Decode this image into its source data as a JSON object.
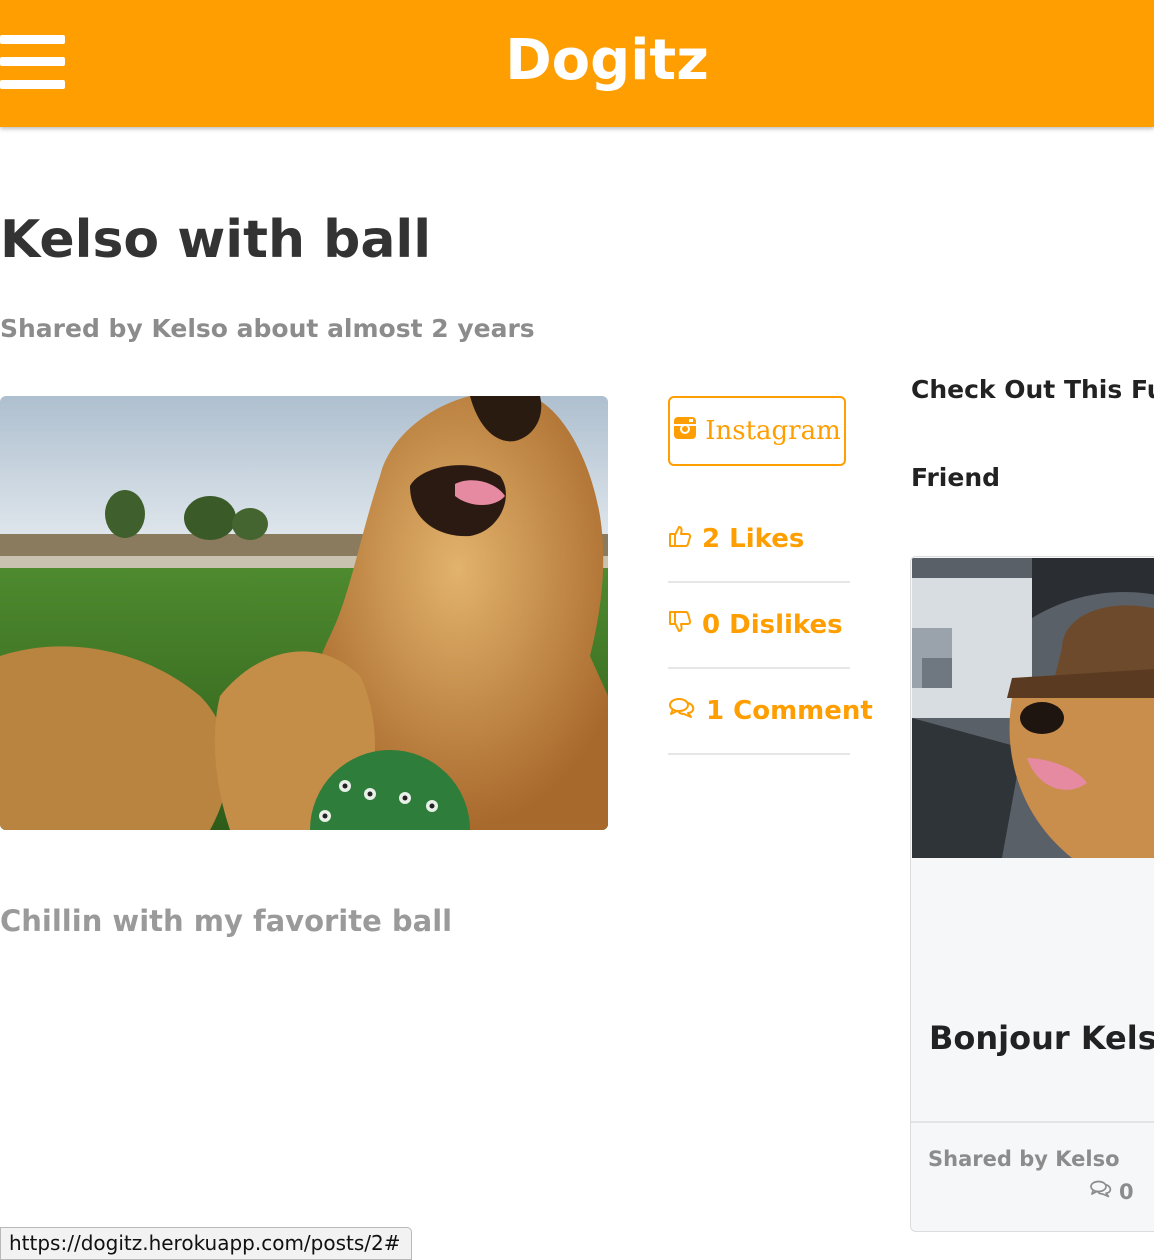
{
  "navbar": {
    "brand": "Dogitz",
    "menu_icon": "hamburger-menu-icon",
    "background_color": "#ff9e00"
  },
  "post": {
    "title": "Kelso with ball",
    "shared_by": "Shared by Kelso about almost 2 years",
    "caption": "Chillin with my favorite ball"
  },
  "actions": {
    "instagram_label": "Instagram",
    "instagram_icon": "instagram-icon",
    "likes_label": "2 Likes",
    "likes_icon": "thumbs-up-icon",
    "dislikes_label": "0 Dislikes",
    "dislikes_icon": "thumbs-down-icon",
    "comments_label": "1 Comment",
    "comments_icon": "comments-icon"
  },
  "sidebar": {
    "heading": "Check Out This Fur",
    "subheading": "Friend",
    "card": {
      "title": "Bonjour Kelso",
      "shared_by": "Shared by Kelso",
      "comment_count": "0",
      "comment_icon": "comments-icon"
    }
  },
  "status_bar": {
    "url": "https://dogitz.herokuapp.com/posts/2#"
  },
  "colors": {
    "accent": "#ff9e00",
    "muted_text": "#8c8c8c",
    "heading_text": "#333333"
  }
}
